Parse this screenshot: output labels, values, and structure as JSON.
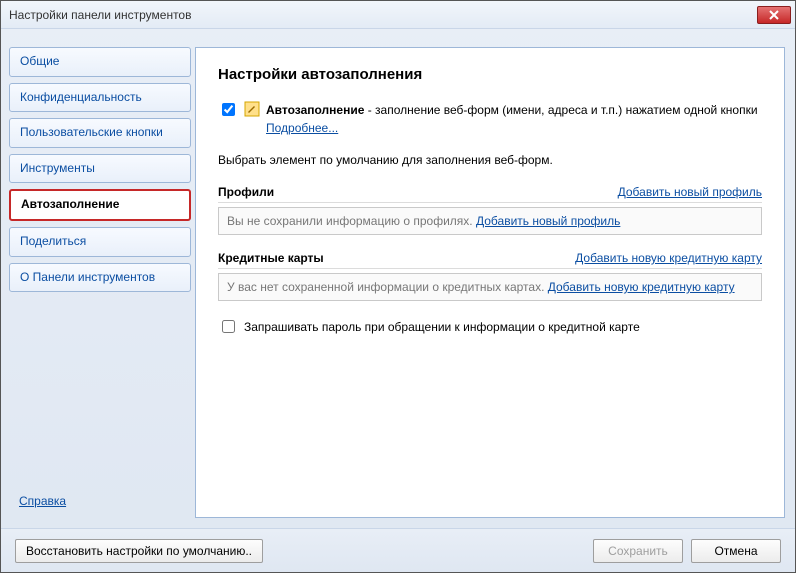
{
  "window": {
    "title": "Настройки панели инструментов"
  },
  "sidebar": {
    "items": [
      {
        "label": "Общие"
      },
      {
        "label": "Конфиденциальность"
      },
      {
        "label": "Пользовательские кнопки"
      },
      {
        "label": "Инструменты"
      },
      {
        "label": "Автозаполнение"
      },
      {
        "label": "Поделиться"
      },
      {
        "label": "О Панели инструментов"
      }
    ],
    "help": "Справка"
  },
  "main": {
    "heading": "Настройки автозаполнения",
    "autofill": {
      "checked": true,
      "name": "Автозаполнение",
      "desc": " - заполнение веб-форм (имени, адреса и т.п.) нажатием одной кнопки  ",
      "more": "Подробнее..."
    },
    "choose_text": "Выбрать элемент по умолчанию для заполнения веб-форм.",
    "profiles": {
      "title": "Профили",
      "add_link": "Добавить новый профиль",
      "empty_text": "Вы не сохранили информацию о профилях. ",
      "inline_link": "Добавить новый профиль"
    },
    "cards": {
      "title": "Кредитные карты",
      "add_link": "Добавить новую кредитную карту",
      "empty_text": "У вас нет сохраненной информации о кредитных картах. ",
      "inline_link": "Добавить новую кредитную карту",
      "ask_password_label": "Запрашивать пароль при обращении к информации о кредитной карте",
      "ask_password_checked": false
    }
  },
  "footer": {
    "restore": "Восстановить настройки по умолчанию..",
    "save": "Сохранить",
    "cancel": "Отмена"
  }
}
